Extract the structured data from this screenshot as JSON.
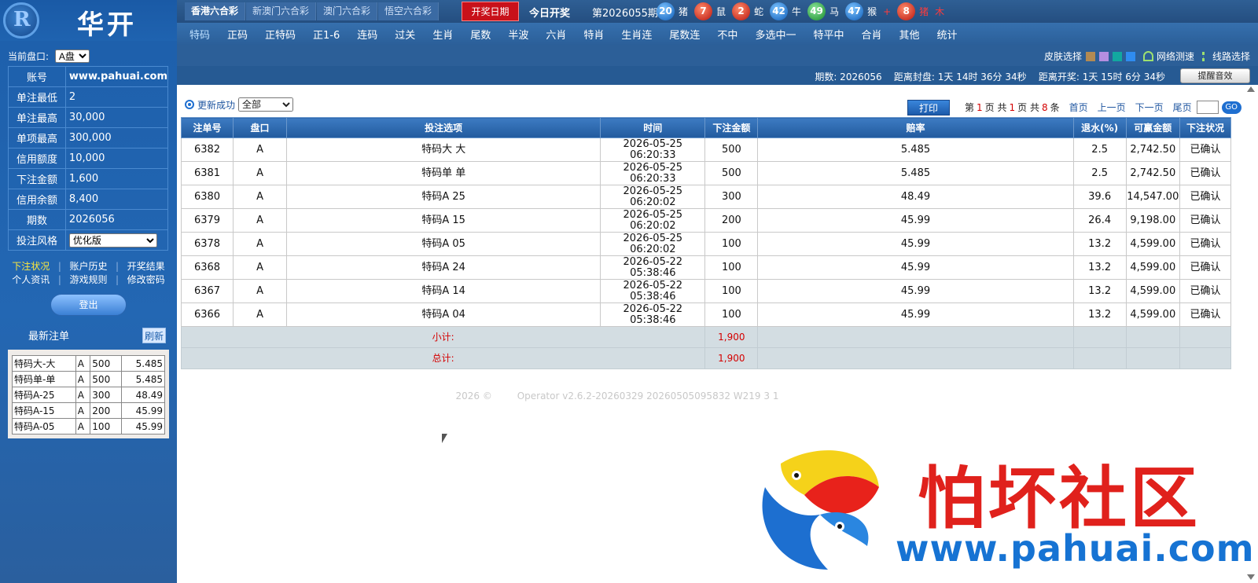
{
  "brand": {
    "logo_glyph": "R",
    "title": "华开",
    "watermark_text": "怕坏社区",
    "watermark_url": "www.pahuai.com"
  },
  "sidebar": {
    "pan_label": "当前盘口:",
    "pan_value": "A盘",
    "account": [
      {
        "key": "账号",
        "value": "www.pahuai.com"
      },
      {
        "key": "单注最低",
        "value": "2"
      },
      {
        "key": "单注最高",
        "value": "30,000"
      },
      {
        "key": "单项最高",
        "value": "300,000"
      },
      {
        "key": "信用额度",
        "value": "10,000"
      },
      {
        "key": "下注金额",
        "value": "1,600"
      },
      {
        "key": "信用余额",
        "value": "8,400"
      },
      {
        "key": "期数",
        "value": "2026056"
      },
      {
        "key": "投注风格",
        "value": "优化版"
      }
    ],
    "links_row1": [
      "下注状况",
      "账户历史",
      "开奖结果"
    ],
    "links_row2": [
      "个人资讯",
      "游戏规则",
      "修改密码"
    ],
    "logout": "登出",
    "recent_title": "最新注单",
    "refresh": "刷新",
    "recent": [
      [
        "特码大-大",
        "A",
        "500",
        "5.485"
      ],
      [
        "特码单-单",
        "A",
        "500",
        "5.485"
      ],
      [
        "特码A-25",
        "A",
        "300",
        "48.49"
      ],
      [
        "特码A-15",
        "A",
        "200",
        "45.99"
      ],
      [
        "特码A-05",
        "A",
        "100",
        "45.99"
      ]
    ]
  },
  "topbar": {
    "lotto_tabs": [
      "香港六合彩",
      "新澳门六合彩",
      "澳门六合彩",
      "悟空六合彩"
    ],
    "draw_date": "开奖日期",
    "today": "今日开奖",
    "period": "第2026055期",
    "balls": [
      {
        "n": "20",
        "zodiac": "猪",
        "color": "blue"
      },
      {
        "n": "7",
        "zodiac": "鼠",
        "color": "red"
      },
      {
        "n": "2",
        "zodiac": "蛇",
        "color": "red"
      },
      {
        "n": "42",
        "zodiac": "牛",
        "color": "blue"
      },
      {
        "n": "49",
        "zodiac": "马",
        "color": "green"
      },
      {
        "n": "47",
        "zodiac": "猴",
        "color": "blue"
      }
    ],
    "special_sep": "+",
    "special": {
      "n": "8",
      "zodiac": "猪",
      "color": "red"
    },
    "special_extra": "木"
  },
  "nav": [
    "特码",
    "正码",
    "正特码",
    "正1-6",
    "连码",
    "过关",
    "生肖",
    "尾数",
    "半波",
    "六肖",
    "特肖",
    "生肖连",
    "尾数连",
    "不中",
    "多选中一",
    "特平中",
    "合肖",
    "其他",
    "统计"
  ],
  "toolbar": {
    "skin_label": "皮肤选择",
    "skin_colors": [
      "#b38a52",
      "#b48ee0",
      "#12a8a0",
      "#2f8cf0"
    ],
    "speed": "网络测速",
    "line": "线路选择",
    "info": "期数: 2026056    距离封盘: 1天 14时 36分 34秒    距离开奖: 1天 15时 6分 34秒",
    "remind": "提醒音效"
  },
  "main": {
    "status": "更新成功",
    "filter": "全部",
    "print": "打印",
    "pager": {
      "p1": "第",
      "cur": "1",
      "p2": "页 共",
      "total_pages": "1",
      "p3": "页 共",
      "count": "8",
      "p4": "条",
      "first": "首页",
      "prev": "上一页",
      "next": "下一页",
      "last": "尾页",
      "go": "GO"
    },
    "columns": [
      "注单号",
      "盘口",
      "投注选项",
      "时间",
      "下注金额",
      "赔率",
      "退水(%)",
      "可赢金额",
      "下注状况"
    ],
    "rows": [
      [
        "6382",
        "A",
        "特码大 大",
        "2026-05-25 06:20:33",
        "500",
        "5.485",
        "2.5",
        "2,742.50",
        "已确认"
      ],
      [
        "6381",
        "A",
        "特码单 单",
        "2026-05-25 06:20:33",
        "500",
        "5.485",
        "2.5",
        "2,742.50",
        "已确认"
      ],
      [
        "6380",
        "A",
        "特码A 25",
        "2026-05-25 06:20:02",
        "300",
        "48.49",
        "39.6",
        "14,547.00",
        "已确认"
      ],
      [
        "6379",
        "A",
        "特码A 15",
        "2026-05-25 06:20:02",
        "200",
        "45.99",
        "26.4",
        "9,198.00",
        "已确认"
      ],
      [
        "6378",
        "A",
        "特码A 05",
        "2026-05-25 06:20:02",
        "100",
        "45.99",
        "13.2",
        "4,599.00",
        "已确认"
      ],
      [
        "6368",
        "A",
        "特码A 24",
        "2026-05-22 05:38:46",
        "100",
        "45.99",
        "13.2",
        "4,599.00",
        "已确认"
      ],
      [
        "6367",
        "A",
        "特码A 14",
        "2026-05-22 05:38:46",
        "100",
        "45.99",
        "13.2",
        "4,599.00",
        "已确认"
      ],
      [
        "6366",
        "A",
        "特码A 04",
        "2026-05-22 05:38:46",
        "100",
        "45.99",
        "13.2",
        "4,599.00",
        "已确认"
      ]
    ],
    "subtotal_label": "小计:",
    "subtotal": "1,900",
    "total_label": "总计:",
    "total": "1,900",
    "footer_year": "2026 ©",
    "footer_ver": "Operator v2.6.2-20260329 20260505095832 W219 3 1"
  }
}
